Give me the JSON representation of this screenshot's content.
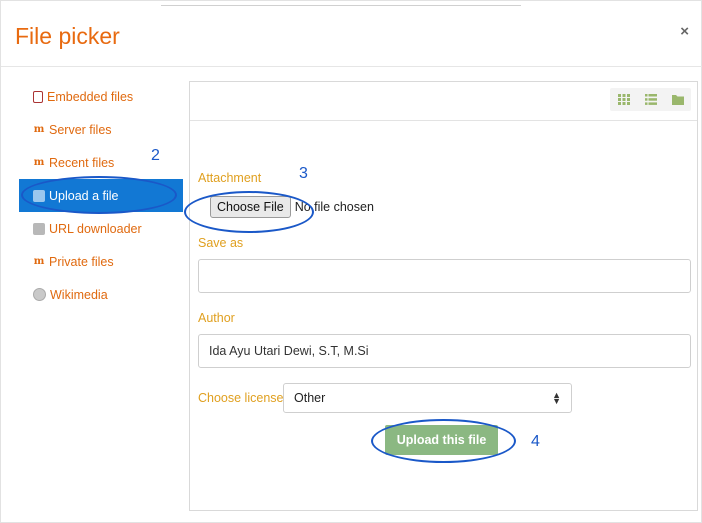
{
  "dialog": {
    "title": "File picker",
    "close_label": "×"
  },
  "sidebar": {
    "items": [
      {
        "label": "Embedded files",
        "icon": "file-icon"
      },
      {
        "label": "Server files",
        "icon": "moodle-icon"
      },
      {
        "label": "Recent files",
        "icon": "moodle-icon"
      },
      {
        "label": "Upload a file",
        "icon": "upload-icon",
        "active": true
      },
      {
        "label": "URL downloader",
        "icon": "url-icon"
      },
      {
        "label": "Private files",
        "icon": "moodle-icon"
      },
      {
        "label": "Wikimedia",
        "icon": "globe-icon"
      }
    ]
  },
  "toolbar": {
    "icons": [
      "grid-view-icon",
      "list-view-icon",
      "folder-view-icon"
    ]
  },
  "form": {
    "attachment_label": "Attachment",
    "choose_file_label": "Choose File",
    "no_file_text": "No file chosen",
    "save_as_label": "Save as",
    "save_as_value": "",
    "author_label": "Author",
    "author_value": "Ida Ayu Utari Dewi, S.T, M.Si",
    "license_label": "Choose license",
    "license_value": "Other",
    "upload_button": "Upload this file"
  },
  "annotations": {
    "step2": "2",
    "step3": "3",
    "step4": "4"
  },
  "colors": {
    "accent": "#e86a10",
    "active": "#1278d4",
    "label": "#e0a020",
    "upload_button": "#8bb882",
    "annotation": "#1a58c8"
  }
}
